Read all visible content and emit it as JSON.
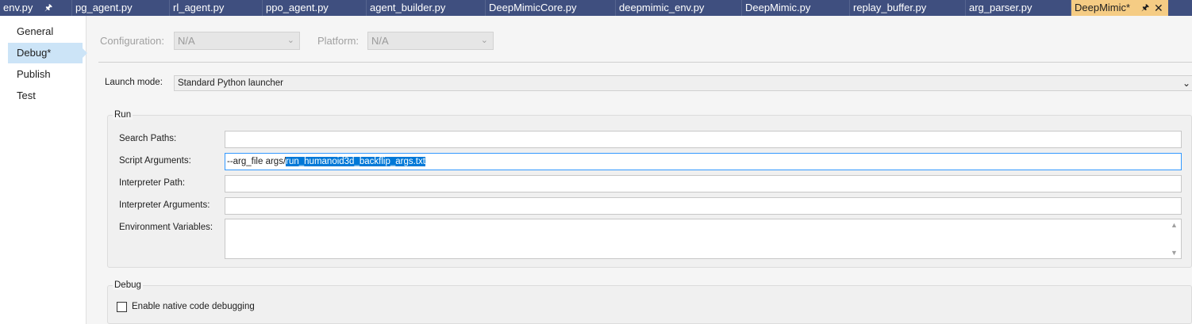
{
  "tabs": [
    {
      "label": "env.py",
      "pinned": true
    },
    {
      "label": "pg_agent.py"
    },
    {
      "label": "rl_agent.py"
    },
    {
      "label": "ppo_agent.py"
    },
    {
      "label": "agent_builder.py"
    },
    {
      "label": "DeepMimicCore.py"
    },
    {
      "label": "deepmimic_env.py"
    },
    {
      "label": "DeepMimic.py"
    },
    {
      "label": "replay_buffer.py"
    },
    {
      "label": "arg_parser.py"
    },
    {
      "label": "DeepMimic*",
      "active": true,
      "pinned": true
    }
  ],
  "nav": {
    "items": [
      {
        "label": "General"
      },
      {
        "label": "Debug*",
        "selected": true
      },
      {
        "label": "Publish"
      },
      {
        "label": "Test"
      }
    ]
  },
  "config": {
    "configuration_label": "Configuration:",
    "configuration_value": "N/A",
    "platform_label": "Platform:",
    "platform_value": "N/A"
  },
  "launch": {
    "label": "Launch mode:",
    "value": "Standard Python launcher"
  },
  "run": {
    "title": "Run",
    "search_paths_label": "Search Paths:",
    "search_paths_value": "",
    "script_args_label": "Script Arguments:",
    "script_args_prefix": "--arg_file args/",
    "script_args_selected": "run_humanoid3d_backflip_args.txt",
    "interpreter_path_label": "Interpreter Path:",
    "interpreter_path_value": "",
    "interpreter_args_label": "Interpreter Arguments:",
    "interpreter_args_value": "",
    "env_vars_label": "Environment Variables:",
    "env_vars_value": ""
  },
  "debug": {
    "title": "Debug",
    "native_debug_label": "Enable native code debugging",
    "native_debug_checked": false
  },
  "colors": {
    "tab_bar": "#3f4f7f",
    "active_tab": "#f5cc84",
    "nav_selected": "#cce4f7",
    "selection": "#0078d7"
  }
}
